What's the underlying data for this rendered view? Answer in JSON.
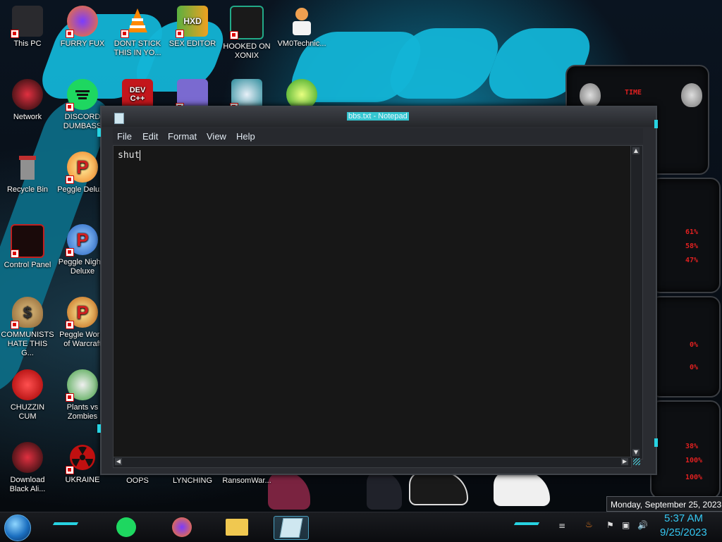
{
  "desktop": {
    "icons": [
      {
        "label": "This PC"
      },
      {
        "label": "FURRY FUX"
      },
      {
        "label": "DONT STICK THIS IN YO..."
      },
      {
        "label": "SEX EDITOR"
      },
      {
        "label": "HOOKED ON XONIX"
      },
      {
        "label": "VM0Technic..."
      },
      {
        "label": "Network"
      },
      {
        "label": "DISCORD DUMBASS"
      },
      {
        "label": "Recycle Bin"
      },
      {
        "label": "Peggle Deluxe"
      },
      {
        "label": "Control Panel"
      },
      {
        "label": "Peggle Nights Deluxe"
      },
      {
        "label": "COMMUNISTS HATE THIS G..."
      },
      {
        "label": "Peggle World of Warcraft"
      },
      {
        "label": "CHUZZIN CUM"
      },
      {
        "label": "Plants vs Zombies"
      },
      {
        "label": "Download Black Ali..."
      },
      {
        "label": "UKRAINE"
      },
      {
        "label": "OOPS"
      },
      {
        "label": "LYNCHING"
      },
      {
        "label": "RansomWar..."
      }
    ],
    "dev_icon_text": "DEV\nC++"
  },
  "notepad": {
    "title": "bbs.txt - Notepad",
    "menu": [
      "File",
      "Edit",
      "Format",
      "View",
      "Help"
    ],
    "content": "shut"
  },
  "taskbar": {
    "time": "5:37 AM",
    "date": "9/25/2023",
    "tooltip": "Monday, September 25, 2023"
  },
  "colors": {
    "accent": "#27d3e2",
    "clock": "#35c6f0",
    "widget_red": "#e02020"
  }
}
